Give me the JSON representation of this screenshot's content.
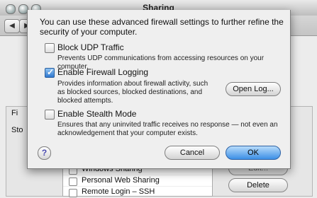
{
  "window": {
    "title": "Sharing"
  },
  "background": {
    "firewall_label": "Fi",
    "stop_label": "Sto",
    "list_items": [
      {
        "label": "Windows Sharing"
      },
      {
        "label": "Personal Web Sharing"
      },
      {
        "label": "Remote Login – SSH"
      }
    ],
    "delete_button": "Delete",
    "edit_button": "Edit..."
  },
  "sheet": {
    "intro": "You can use these advanced firewall settings to further refine the security of your computer.",
    "options": [
      {
        "label": "Block UDP Traffic",
        "checked": false,
        "description": "Prevents UDP communications from accessing resources on your computer."
      },
      {
        "label": "Enable Firewall Logging",
        "checked": true,
        "description": "Provides information about firewall activity, such as blocked sources, blocked destinations, and blocked attempts."
      },
      {
        "label": "Enable Stealth Mode",
        "checked": false,
        "description": "Ensures that any uninvited traffic receives no response — not even an acknowledgement that your computer exists."
      }
    ],
    "open_log_button": "Open Log...",
    "cancel_button": "Cancel",
    "ok_button": "OK",
    "help_glyph": "?"
  }
}
